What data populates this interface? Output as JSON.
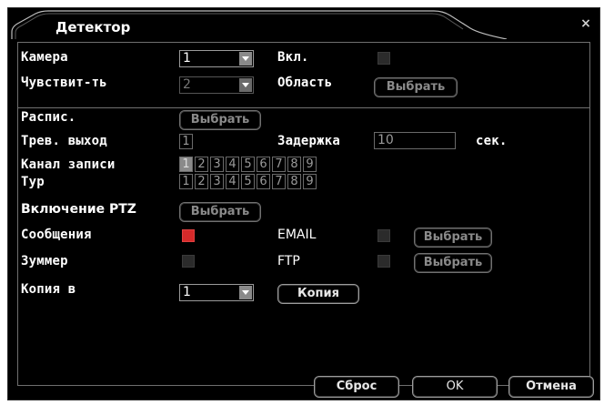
{
  "dialog": {
    "title": "Детектор",
    "close_glyph": "×"
  },
  "fields": {
    "camera_label": "Камера",
    "camera_value": "1",
    "enable_label": "Вкл.",
    "sensitivity_label": "Чувствит-ть",
    "sensitivity_value": "2",
    "area_label": "Область",
    "area_button": "Выбрать",
    "schedule_label": "Распис.",
    "schedule_button": "Выбрать",
    "alarm_out_label": "Трев. выход",
    "alarm_out_value": "1",
    "delay_label": "Задержка",
    "delay_value": "10",
    "delay_unit": "сек.",
    "record_channel_label": "Канал записи",
    "record_channels": [
      "1",
      "2",
      "3",
      "4",
      "5",
      "6",
      "7",
      "8",
      "9"
    ],
    "tour_label": "Тур",
    "tour_channels": [
      "1",
      "2",
      "3",
      "4",
      "5",
      "6",
      "7",
      "8",
      "9"
    ],
    "ptz_label": "Включение PTZ",
    "ptz_button": "Выбрать",
    "messages_label": "Сообщения",
    "email_label": "EMAIL",
    "email_button": "Выбрать",
    "buzzer_label": "Зуммер",
    "ftp_label": "FTP",
    "ftp_button": "Выбрать",
    "copy_to_label": "Копия в",
    "copy_to_value": "1",
    "copy_button": "Копия"
  },
  "footer": {
    "reset_button": "Сброс",
    "ok_button": "OK",
    "cancel_button": "Отмена"
  },
  "colors": {
    "background": "#000000",
    "text": "#ffffff",
    "checked": "#d62a2a",
    "border": "#9a9a9a"
  }
}
